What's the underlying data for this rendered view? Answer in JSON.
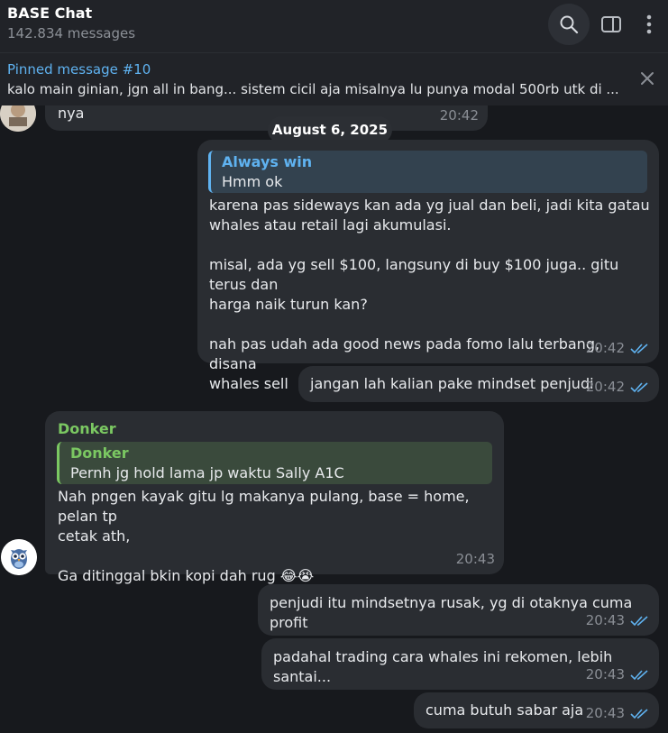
{
  "header": {
    "title": "BASE Chat",
    "subtitle": "142.834 messages"
  },
  "pinned": {
    "title": "Pinned message #10",
    "text": "kalo main ginian, jgn all in bang... sistem cicil aja  misalnya lu punya modal 500rb utk di ..."
  },
  "date_separator": "August 6, 2025",
  "messages": [
    {
      "id": "m0",
      "text": "nya",
      "time": "20:42"
    },
    {
      "id": "m1",
      "reply": {
        "name": "Always win",
        "text": "Hmm ok"
      },
      "text": "karena pas sideways kan ada yg jual dan beli, jadi kita gatau\nwhales atau retail lagi akumulasi.\n\nmisal, ada yg sell $100, langsuny di buy $100 juga.. gitu terus dan\nharga naik turun kan?\n\nnah pas udah ada good news pada fomo lalu terbang, disana\nwhales sell",
      "time": "20:42"
    },
    {
      "id": "m2",
      "text": "jangan lah kalian pake mindset penjudi",
      "time": "20:42"
    },
    {
      "id": "m3",
      "sender": "Donker",
      "reply": {
        "name": "Donker",
        "text": "Pernh jg hold lama jp waktu Sally A1C"
      },
      "text": "Nah pngen kayak gitu lg makanya pulang, base = home, pelan tp\ncetak ath,\n\nGa ditinggal bkin kopi dah rug 😂😭",
      "time": "20:43"
    },
    {
      "id": "m4",
      "text": "penjudi itu mindsetnya rusak, yg di otaknya cuma profit",
      "time": "20:43"
    },
    {
      "id": "m5",
      "text": "padahal trading cara whales ini rekomen, lebih santai...",
      "time": "20:43"
    },
    {
      "id": "m6",
      "text": "cuma butuh sabar aja",
      "time": "20:43"
    }
  ],
  "colors": {
    "accent": "#5fb2f0",
    "donker_green": "#7bc862",
    "reply_blue_bg": "#33424f",
    "reply_green_bg": "#3a4a3c",
    "bubble": "#2a2d32",
    "background": "#17191d"
  },
  "icons": [
    "search-icon",
    "sidebar-toggle-icon",
    "more-vertical-icon",
    "close-icon",
    "double-check-icon",
    "owl-avatar",
    "user-avatar"
  ]
}
